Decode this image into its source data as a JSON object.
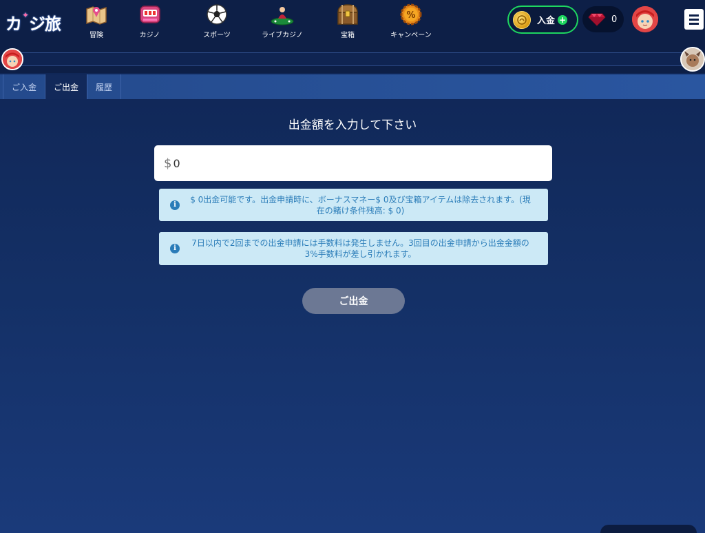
{
  "brand": {
    "logo_text": "カジ旅"
  },
  "nav": [
    {
      "label": "冒険",
      "icon": "map-icon"
    },
    {
      "label": "カジノ",
      "icon": "slot-machine-icon"
    },
    {
      "label": "スポーツ",
      "icon": "soccer-ball-icon"
    },
    {
      "label": "ライブカジノ",
      "icon": "live-dealer-icon"
    },
    {
      "label": "宝箱",
      "icon": "treasure-chest-icon"
    },
    {
      "label": "キャンペーン",
      "icon": "campaign-gear-icon"
    }
  ],
  "header": {
    "deposit_label": "入金",
    "gem_count": "0"
  },
  "tabs": [
    {
      "label": "ご入金",
      "active": false
    },
    {
      "label": "ご出金",
      "active": true
    },
    {
      "label": "履歴",
      "active": false
    }
  ],
  "main": {
    "title": "出金額を入力して下さい",
    "currency": "$",
    "amount_value": "0",
    "info1": "$ 0出金可能です。出金申請時に、ボーナスマネー$ 0及び宝箱アイテムは除去されます。(現在の賭け条件残高: $ 0)",
    "info2": "7日以内で2回までの出金申請には手数料は発生しません。3回目の出金申請から出金金額の3%手数料が差し引かれます。",
    "withdraw_button": "ご出金"
  },
  "colors": {
    "accent_green": "#1ed760",
    "info_bg": "#cce9f6",
    "info_text": "#2a7cb8",
    "button_disabled": "#6c7894"
  }
}
